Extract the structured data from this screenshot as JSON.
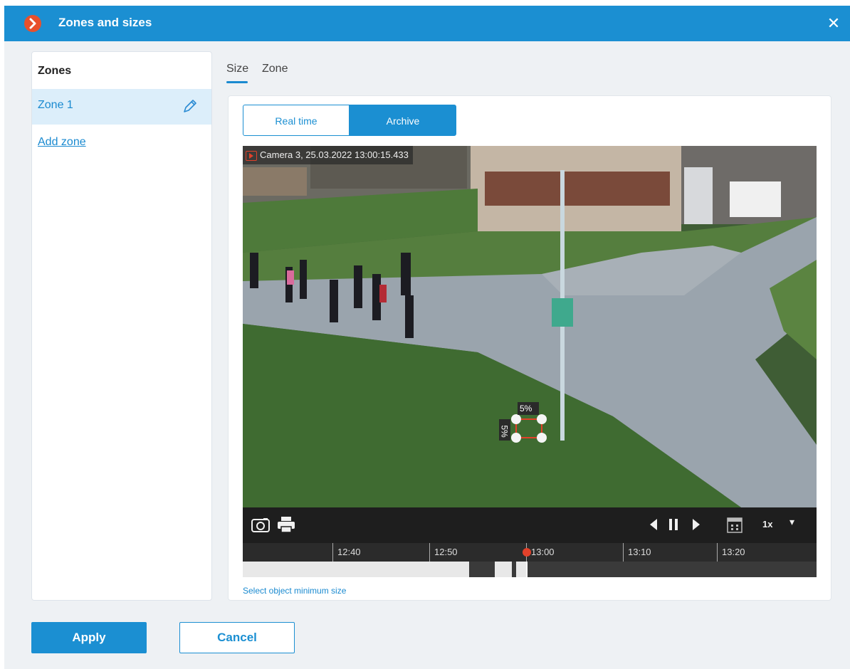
{
  "window": {
    "title": "Zones and sizes",
    "close_icon": "close-icon"
  },
  "zones_panel": {
    "heading": "Zones",
    "items": [
      {
        "label": "Zone 1",
        "selected": true
      }
    ],
    "add_link": "Add zone"
  },
  "tabs": [
    {
      "label": "Size",
      "active": true
    },
    {
      "label": "Zone",
      "active": false
    }
  ],
  "mode_toggle": {
    "options": [
      "Real time",
      "Archive"
    ],
    "selected": "Archive"
  },
  "video": {
    "camera_label": "Camera 3, 25.03.2022 13:00:15.433",
    "size_box": {
      "width_label": "5%",
      "height_label": "5%"
    }
  },
  "controls": {
    "speed": "1x"
  },
  "timeline": {
    "ticks": [
      "12:40",
      "12:50",
      "13:00",
      "13:10",
      "13:20"
    ]
  },
  "hint": "Select object minimum size",
  "buttons": {
    "apply": "Apply",
    "cancel": "Cancel"
  },
  "colors": {
    "accent": "#1b8fd2",
    "title_icon": "#e8502c",
    "playhead": "#e2412a"
  }
}
